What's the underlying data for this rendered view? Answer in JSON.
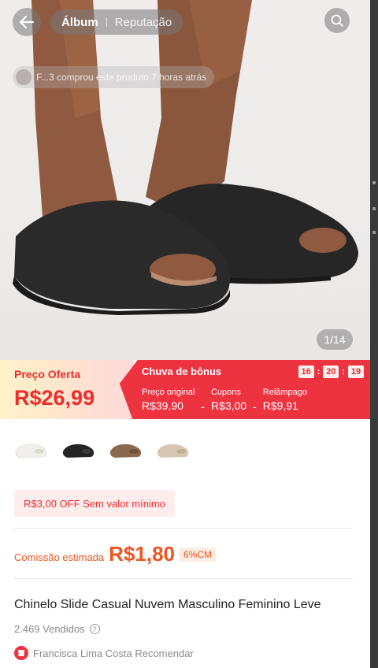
{
  "header": {
    "tabs": [
      {
        "label": "Álbum",
        "active": true
      },
      {
        "label": "Reputação",
        "active": false
      }
    ]
  },
  "gallery": {
    "notification": "F...3 comprou este produto 7 horas atrás",
    "counter": "1/14"
  },
  "price_banner": {
    "offer_label": "Preço Oferta",
    "offer_price": "R$26,99",
    "bonus_title": "Chuva de bônus",
    "timer": {
      "h": "16",
      "m": "20",
      "s": "19"
    },
    "breakdown": [
      {
        "label": "Preço original",
        "value": "R$39,90"
      },
      {
        "label": "Cupons",
        "value": "R$3,00"
      },
      {
        "label": "Relâmpago",
        "value": "R$9,91"
      }
    ],
    "separator": "-"
  },
  "variants": [
    {
      "name": "white",
      "color": "#f1efe9"
    },
    {
      "name": "black",
      "color": "#242424"
    },
    {
      "name": "brown",
      "color": "#8a6a4e"
    },
    {
      "name": "beige",
      "color": "#d7c7b0"
    }
  ],
  "coupon": {
    "label": "R$3,00 OFF Sem valor mínimo"
  },
  "commission": {
    "label": "Comissão estimada",
    "amount": "R$1,80",
    "percent": "6%CM"
  },
  "product": {
    "title": "Chinelo Slide Casual Nuvem Masculino Feminino Leve",
    "sold": "2.469 Vendidos",
    "recommend": "Francisca Lima Costa Recomendar"
  },
  "colors": {
    "accent": "#ee3340",
    "commission": "#f0541f"
  }
}
